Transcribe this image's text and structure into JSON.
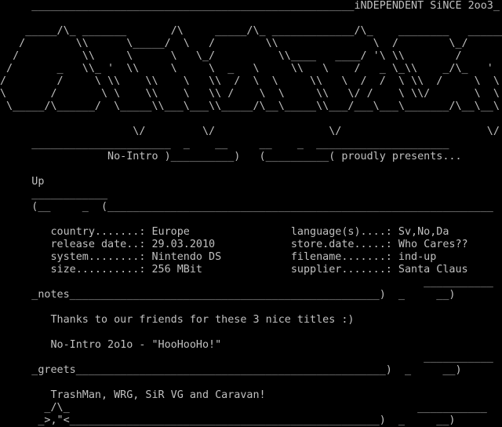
{
  "document": {
    "text_color": "#c0c0c0",
    "background": "#000000",
    "lines": [
      "     ___________________________________________________iNDEPENDENT SiNCE 2oo3_",
      "",
      "    _____/\\_ _______       /\\     _____/\\_ _____________/\\_    ________   _______",
      "   /        \\\\      \\_____/  \\   /        \\\\               \\  /        \\_/       \\",
      "  /          \\\\     \\      \\   \\_/          \\\\____   ____/ '\\ \\\\        /         \\",
      " /       _   \\\\_ '  \\\\     \\     \\  _   \\     \\\\   \\    /   _ \\_\\\\    _/\\_   '  \\",
      "/        /     \\ \\\\    \\\\    \\   \\\\  /  \\  \\     \\\\   \\  /  /  \\ \\\\  /     \\  \\  \\",
      "\\       /       \\ \\    \\\\    \\   \\\\ /    \\  \\     \\\\   \\/ /    \\ \\\\/       \\  \\  \\",
      " \\_____/\\______/  \\_____\\\\___\\___\\\\_____/\\__\\_____\\\\___/___\\___\\_______/\\__\\__\\",
      "",
      "                     \\/         \\/                  \\/                       \\/",
      "     ______________________  _    __     __    _  _____________________",
      "                 No-Intro )__________)   (__________( proudly presents...",
      "",
      "     Up",
      "     ____________",
      "     (__     _  (_____________________________________________________________",
      "",
      "        country.......: Europe                language(s)....: Sv,No,Da",
      "        release date..: 29.03.2010            store.date.....: Who Cares??",
      "        system........: Nintendo DS           filename.......: ind-up",
      "        size..........: 256 MBit              supplier.......: Santa Claus",
      "                                                                   ___________",
      "     _notes_________________________________________________)  _     __)",
      "",
      "        Thanks to our friends for these 3 nice titles :)",
      "",
      "        No-Intro 2o1o - \"HooHooHo!\"",
      "                                                                   ___________",
      "     _greets_________________________________________________)  _     __)",
      "",
      "        TrashMan, WRG, SiR VG and Caravan!",
      "       _/\\_                                                       ___________",
      "      _>,\"<_________________________________________________)  _     __)"
    ]
  }
}
